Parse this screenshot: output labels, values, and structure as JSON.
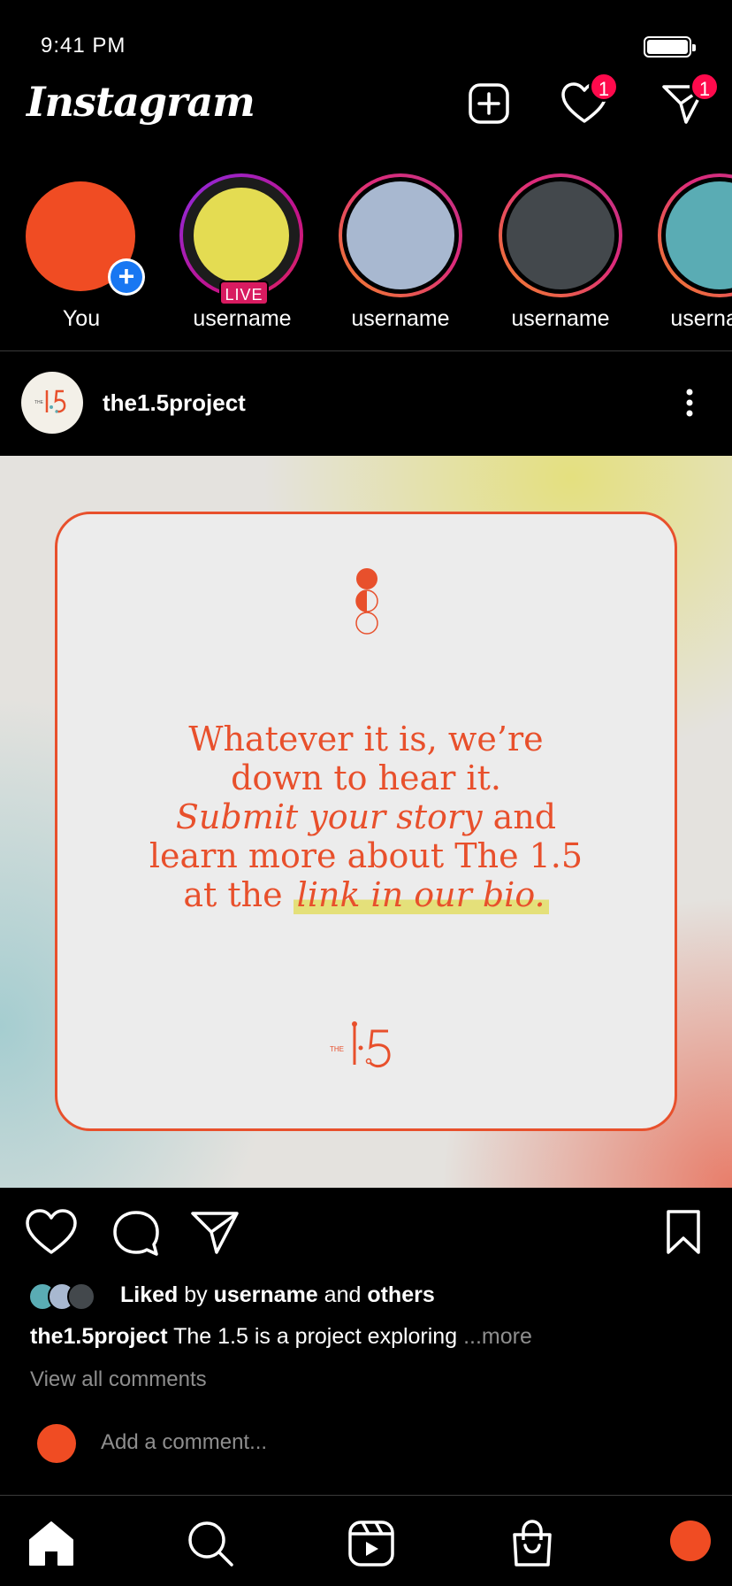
{
  "status_bar": {
    "time": "9:41 PM"
  },
  "header": {
    "app_name": "Instagram",
    "activity_badge": "1",
    "messages_badge": "1"
  },
  "stories": [
    {
      "label": "You",
      "avatar_color": "#f04c23",
      "ring": "none",
      "add": true
    },
    {
      "label": "username",
      "avatar_color": "#e4dc52",
      "ring": "live",
      "live_label": "LIVE"
    },
    {
      "label": "username",
      "avatar_color": "#a8b8d0",
      "ring": "gradient"
    },
    {
      "label": "username",
      "avatar_color": "#43484c",
      "ring": "gradient"
    },
    {
      "label": "username",
      "avatar_color": "#5aacb4",
      "ring": "gradient"
    }
  ],
  "post": {
    "username": "the1.5project",
    "avatar_logo_text": "1·5",
    "image": {
      "quote_line1": "Whatever it is, we’re",
      "quote_line2": "down to hear it.",
      "quote_line3_italic": "Submit your story",
      "quote_line3_rest": " and",
      "quote_line4": "learn more about The 1.5",
      "quote_line5_prefix": "at the ",
      "quote_line5_highlight": "link in our bio.",
      "logo_small_text": "THE",
      "logo_text": "1·5"
    },
    "likes": {
      "prefix": "Liked",
      "by": " by ",
      "user": "username",
      "and": " and ",
      "others": "others",
      "avatar_colors": [
        "#5aacb4",
        "#a8b8d0",
        "#43484c"
      ]
    },
    "caption": {
      "user": "the1.5project",
      "text": " The 1.5 is a project exploring ",
      "more": "...more"
    },
    "view_comments": "View all comments",
    "comment_placeholder": "Add a comment..."
  },
  "colors": {
    "accent": "#e8502c",
    "badge": "#ff0a4c",
    "live": "#d81b60",
    "highlight": "#e4e07a"
  },
  "bottom_nav": [
    "home-icon",
    "search-icon",
    "reels-icon",
    "shop-icon",
    "profile-avatar"
  ]
}
